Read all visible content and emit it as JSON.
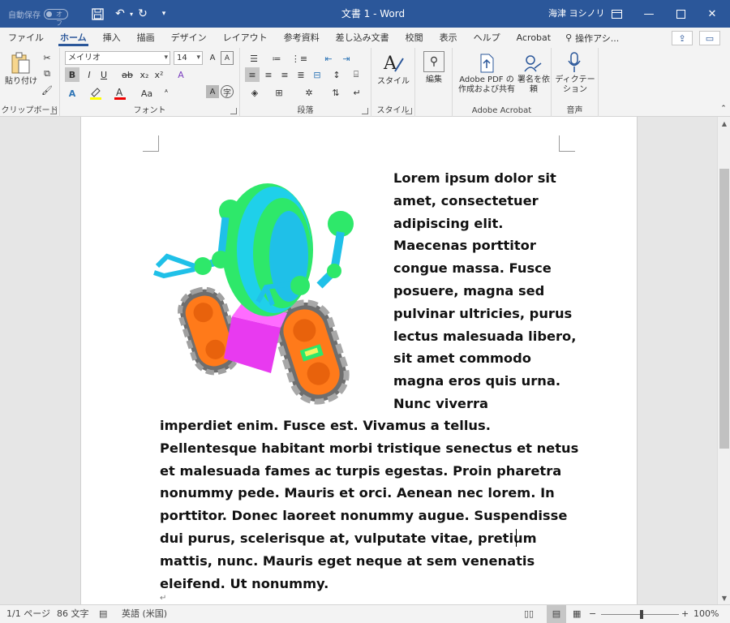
{
  "titlebar": {
    "autosave_label": "自動保存",
    "autosave_state": "オフ",
    "doc_title": "文書 1  -  Word",
    "user_name": "海津 ヨシノリ",
    "bg_color": "#2b579a"
  },
  "tabs": [
    "ファイル",
    "ホーム",
    "挿入",
    "描画",
    "デザイン",
    "レイアウト",
    "参考資料",
    "差し込み文書",
    "校閲",
    "表示",
    "ヘルプ",
    "Acrobat"
  ],
  "active_tab": "ホーム",
  "search_label": "操作アシ...",
  "ribbon": {
    "clipboard": {
      "paste": "貼り付け",
      "label": "クリップボード"
    },
    "font": {
      "name": "メイリオ",
      "size": "14",
      "label": "フォント",
      "bold": "B",
      "italic": "I",
      "underline": "U",
      "strike": "ab",
      "sub": "x₂",
      "sup": "x²",
      "font_color": "A",
      "char_style": "Aa",
      "grow": "A",
      "shrink": "A"
    },
    "paragraph": {
      "label": "段落"
    },
    "styles": {
      "btn": "スタイル",
      "label": "スタイル"
    },
    "editing": {
      "btn": "編集"
    },
    "acrobat": {
      "create_pdf": "Adobe PDF の作成および共有",
      "sign": "署名を依頼",
      "label": "Adobe Acrobat"
    },
    "voice": {
      "dictate": "ディクテーション",
      "label": "音声"
    }
  },
  "document": {
    "text_part1": "Lorem ipsum dolor sit amet, consectetuer adipiscing elit. Maecenas porttitor congue massa. Fusce posuere, magna sed pulvinar ultricies, purus lectus malesuada libero, sit amet commodo magna eros quis urna. Nunc viverra",
    "text_part2": "imperdiet enim. Fusce est. Vivamus a tellus. Pellentesque habitant morbi tristique senectus et netus et malesuada fames ac turpis egestas. Proin pharetra nonummy pede. Mauris et orci. Aenean nec lorem. In porttitor. Donec laoreet nonummy augue. Suspendisse dui purus, scelerisque at, vulputate vitae, pretium mattis, nunc. Mauris eget neque at sem venenatis eleifend. Ut nonummy.",
    "paragraph_mark": "↵"
  },
  "status": {
    "page": "1/1 ページ",
    "words": "86 文字",
    "language": "英語 (米国)",
    "zoom": "100%",
    "zoom_minus": "−",
    "zoom_plus": "+"
  }
}
